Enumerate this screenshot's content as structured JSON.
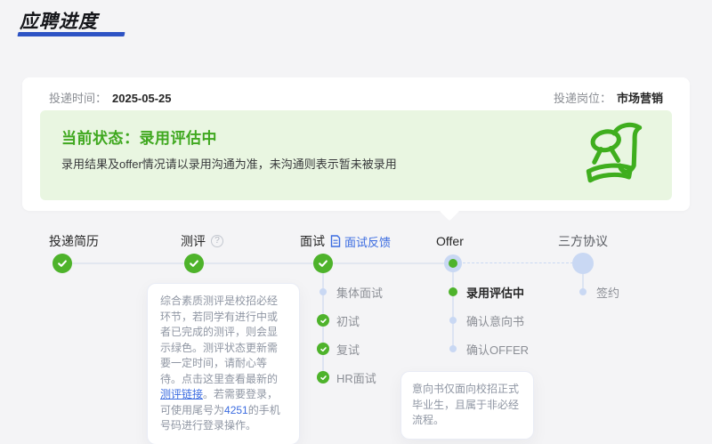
{
  "page": {
    "title": "应聘进度"
  },
  "header": {
    "apply_time_label": "投递时间：",
    "apply_time_value": "2025-05-25",
    "position_label": "投递岗位：",
    "position_value": "市场营销"
  },
  "status": {
    "title": "当前状态：录用评估中",
    "desc": "录用结果及offer情况请以录用沟通为准，未沟通则表示暂未被录用"
  },
  "timeline": {
    "stages": [
      {
        "label": "投递简历",
        "state": "done"
      },
      {
        "label": "测评",
        "state": "done",
        "has_help": true
      },
      {
        "label": "面试",
        "state": "done",
        "feedback_link": "面试反馈"
      },
      {
        "label": "Offer",
        "state": "current"
      },
      {
        "label": "三方协议",
        "state": "pending"
      }
    ],
    "interview_steps": [
      {
        "label": "集体面试",
        "state": "pending"
      },
      {
        "label": "初试",
        "state": "done"
      },
      {
        "label": "复试",
        "state": "done"
      },
      {
        "label": "HR面试",
        "state": "done"
      }
    ],
    "offer_steps": [
      {
        "label": "录用评估中",
        "state": "current"
      },
      {
        "label": "确认意向书",
        "state": "pending"
      },
      {
        "label": "确认OFFER",
        "state": "pending"
      }
    ],
    "agreement_steps": [
      {
        "label": "签约",
        "state": "pending"
      }
    ]
  },
  "tooltips": {
    "assessment": {
      "part1": "综合素质测评是校招必经环节，若同学有进行中或者已完成的测评，则会显示绿色。测评状态更新需要一定时间，请耐心等待。点击这里查看最新的",
      "link_text": "测评链接",
      "part2": "。若需要登录，可使用尾号为",
      "phone_tail": "4251",
      "part3": "的手机号码进行登录操作。"
    },
    "offer_note": "意向书仅面向校招正式毕业生，且属于非必经流程。"
  },
  "glyphs": {
    "help": "?"
  },
  "colors": {
    "page_bg": "#f4f4f6",
    "underline_blue": "#2d53c4",
    "banner_bg": "#e9f6e1",
    "green_strong": "#3fa81f",
    "green_node": "#4eb32b",
    "pending_blue": "#c9d8f3",
    "line_color": "#e2e7f0",
    "stem_color": "#dde4f2",
    "link_blue": "#3a6be0"
  }
}
